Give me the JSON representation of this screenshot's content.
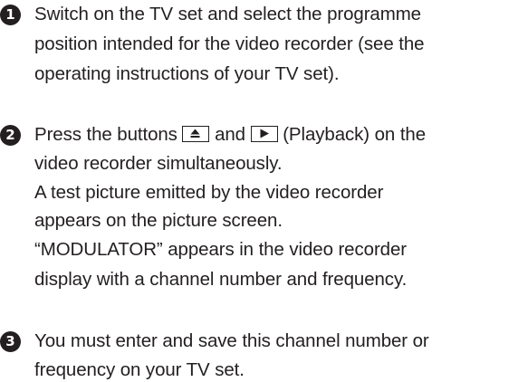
{
  "steps": [
    {
      "number": "1",
      "lines": [
        "Switch on the TV set and select the programme",
        "position intended for the video recorder (see the",
        "operating instructions of your TV set)."
      ]
    },
    {
      "number": "2",
      "line1": {
        "prefix": "Press the buttons",
        "eject_icon": "eject-button-icon",
        "middle": "and",
        "play_icon": "play-button-icon",
        "suffix": "(Playback) on the"
      },
      "lines": [
        "video recorder simultaneously.",
        "A test picture emitted by the video recorder",
        "appears on the picture screen.",
        "“MODULATOR” appears in the video recorder",
        "display with a channel number and frequency."
      ]
    },
    {
      "number": "3",
      "lines": [
        "You must enter and save this channel number or",
        "frequency on your TV set."
      ]
    }
  ]
}
